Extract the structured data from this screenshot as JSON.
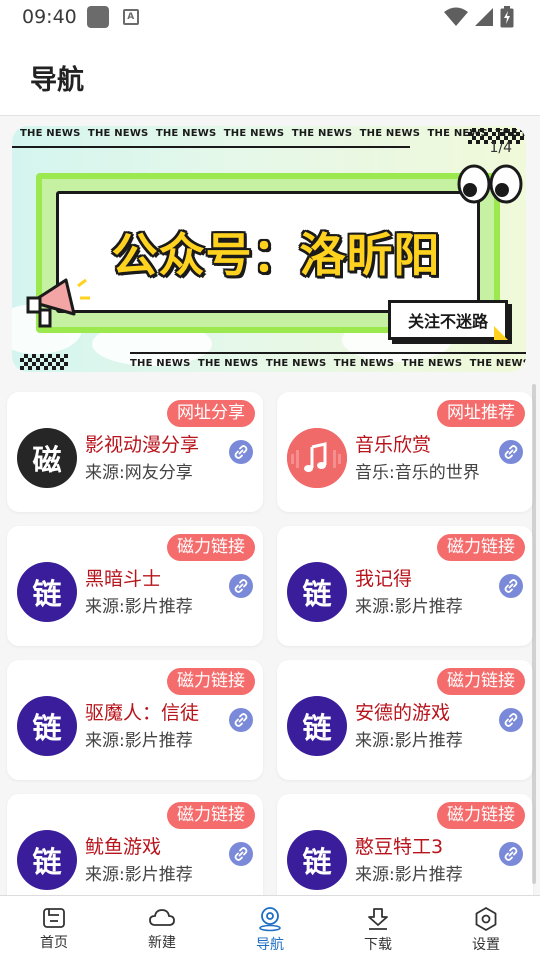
{
  "status_bar": {
    "time": "09:40"
  },
  "header": {
    "title": "导航"
  },
  "banner": {
    "news_text": "THE NEWS",
    "main_text": "公众号：洛昕阳",
    "follow_text": "关注不迷路",
    "counter": "1/4"
  },
  "cards": [
    {
      "tag": "网址分享",
      "avatar_char": "磁",
      "avatar_style": "black",
      "name": "影视动漫分享",
      "source": "来源:网友分享"
    },
    {
      "tag": "网址推荐",
      "avatar_char": "",
      "avatar_style": "music",
      "name": "音乐欣赏",
      "source": "音乐:音乐的世界"
    },
    {
      "tag": "磁力链接",
      "avatar_char": "链",
      "avatar_style": "purple",
      "name": "黑暗斗士",
      "source": "来源:影片推荐"
    },
    {
      "tag": "磁力链接",
      "avatar_char": "链",
      "avatar_style": "purple",
      "name": "我记得",
      "source": "来源:影片推荐"
    },
    {
      "tag": "磁力链接",
      "avatar_char": "链",
      "avatar_style": "purple",
      "name": "驱魔人：信徒",
      "source": "来源:影片推荐"
    },
    {
      "tag": "磁力链接",
      "avatar_char": "链",
      "avatar_style": "purple",
      "name": "安德的游戏",
      "source": "来源:影片推荐"
    },
    {
      "tag": "磁力链接",
      "avatar_char": "链",
      "avatar_style": "purple",
      "name": "鱿鱼游戏",
      "source": "来源:影片推荐"
    },
    {
      "tag": "磁力链接",
      "avatar_char": "链",
      "avatar_style": "purple",
      "name": "憨豆特工3",
      "source": "来源:影片推荐"
    }
  ],
  "bottom_nav": [
    {
      "label": "首页",
      "icon": "home-icon"
    },
    {
      "label": "新建",
      "icon": "cloud-icon"
    },
    {
      "label": "导航",
      "icon": "navigation-icon",
      "active": true
    },
    {
      "label": "下载",
      "icon": "download-icon"
    },
    {
      "label": "设置",
      "icon": "settings-icon"
    }
  ],
  "colors": {
    "tag_bg": "#f46c6c",
    "name_text": "#b8141c",
    "avatar_purple": "#3a1d9a",
    "nav_active": "#1d6fc4",
    "link_button": "#7a8ad8"
  }
}
